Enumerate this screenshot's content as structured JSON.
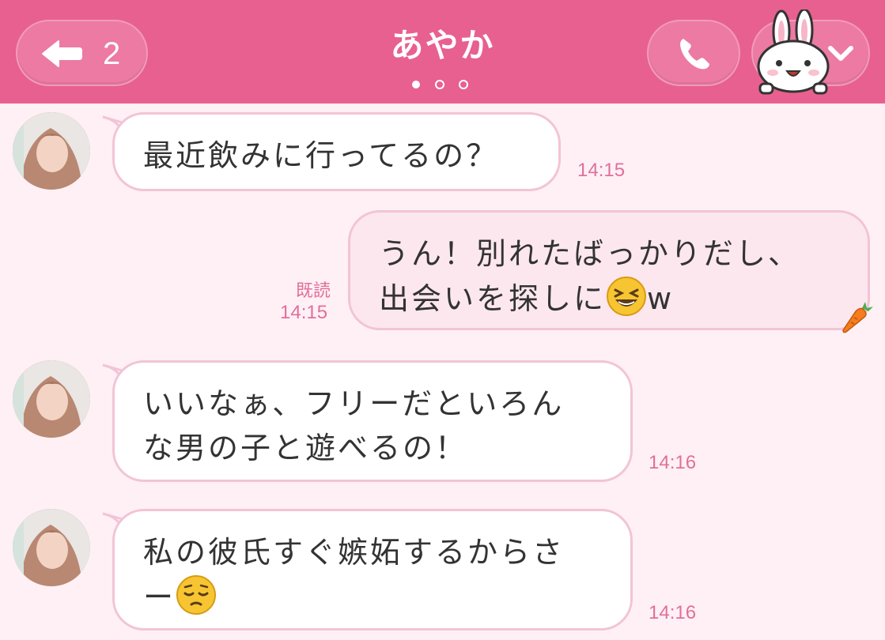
{
  "header": {
    "title": "あやか",
    "back_count": "2",
    "page_dots": 3,
    "active_dot": 0,
    "color": "#e8608f"
  },
  "messages": [
    {
      "side": "left",
      "text_lines": [
        "最近飲みに行ってるの？"
      ],
      "time": "14:15"
    },
    {
      "side": "right",
      "text_lines": [
        "うん！別れたばっかりだし、",
        "出会いを探しに"
      ],
      "emoji": "laughing-face",
      "suffix": "w",
      "read": "既読",
      "time": "14:15"
    },
    {
      "side": "left",
      "text_lines": [
        "いいなぁ、フリーだといろん",
        "な男の子と遊べるの！"
      ],
      "time": "14:16"
    },
    {
      "side": "left",
      "text_lines": [
        "私の彼氏すぐ嫉妬するからさ",
        "ー"
      ],
      "emoji": "pensive-face",
      "time": "14:16"
    }
  ],
  "colors": {
    "background": "#fff0f5",
    "bubble_border": "#f2c4d6",
    "own_bubble": "#fde7ef",
    "time_text": "#e0709a"
  }
}
